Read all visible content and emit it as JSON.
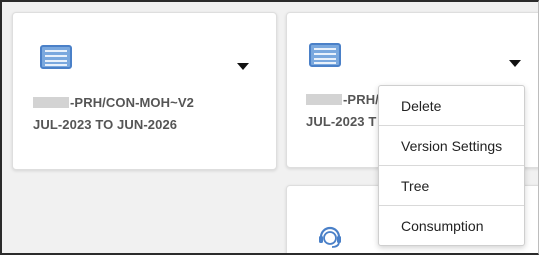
{
  "cards": [
    {
      "icon": "list-icon",
      "menu_toggle_icon": "caret-down-icon",
      "title_line1": "-PRH/CON-MOH~V2",
      "title_line2": "JUL-2023 TO JUN-2026"
    },
    {
      "icon": "list-icon",
      "menu_toggle_icon": "caret-down-icon",
      "title_line1": "-PRH/",
      "title_line2": "JUL-2023 T"
    },
    {
      "icon": "headset-support-icon"
    }
  ],
  "dropdown_menu": {
    "items": [
      "Delete",
      "Version Settings",
      "Tree",
      "Consumption"
    ]
  },
  "colors": {
    "icon_fill": "#7aa8de",
    "icon_border": "#4a80c8",
    "title_text": "#555555"
  }
}
